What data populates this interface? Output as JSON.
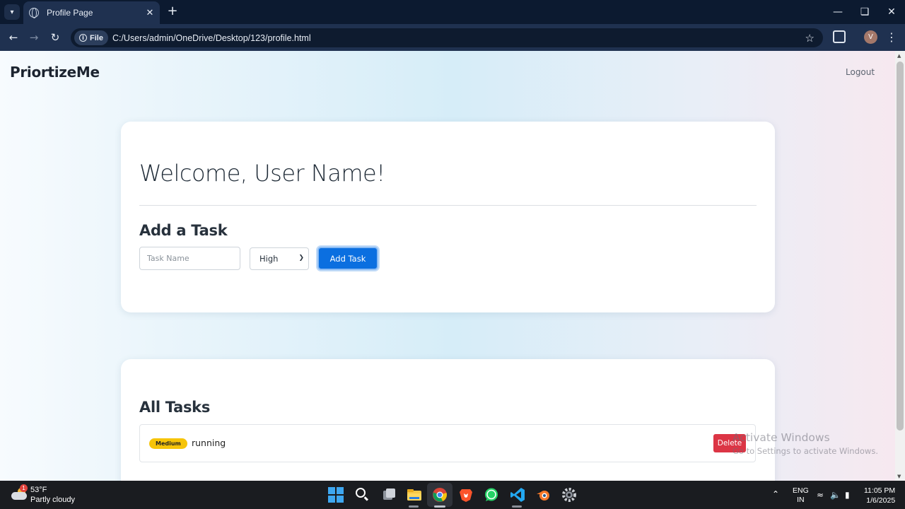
{
  "browser": {
    "tab_title": "Profile Page",
    "site_chip": "File",
    "url": "C:/Users/admin/OneDrive/Desktop/123/profile.html",
    "profile_initial": "V"
  },
  "page": {
    "brand": "PriortizeMe",
    "logout_label": "Logout",
    "welcome": "Welcome, User Name!",
    "add_task_heading": "Add a Task",
    "task_name_placeholder": "Task Name",
    "priority_selected": "High",
    "add_task_button": "Add Task",
    "all_tasks_heading": "All Tasks",
    "tasks": [
      {
        "priority": "Medium",
        "name": "running",
        "delete_label": "Delete",
        "badge_color": "#f6c409"
      }
    ],
    "colors": {
      "primary": "#0b6fe0",
      "danger": "#dc3545",
      "warning": "#f6c409"
    }
  },
  "watermark": {
    "line1": "Activate Windows",
    "line2": "Go to Settings to activate Windows."
  },
  "taskbar": {
    "weather_alert_count": "1",
    "temperature": "53°F",
    "condition": "Partly cloudy",
    "language": "ENG",
    "region": "IN",
    "time": "11:05 PM",
    "date": "1/6/2025",
    "pinned_apps": [
      "windows-start",
      "search",
      "task-view",
      "file-explorer",
      "chrome",
      "brave",
      "whatsapp",
      "vscode",
      "blender",
      "settings"
    ]
  }
}
